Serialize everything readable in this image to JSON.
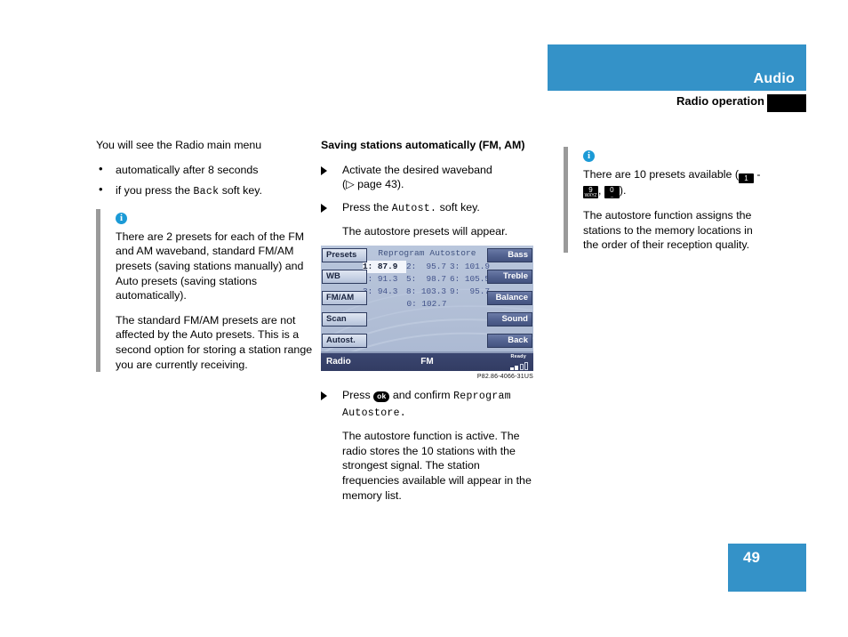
{
  "header": {
    "title": "Audio",
    "subtitle": "Radio operation",
    "band_color": "#3492c8"
  },
  "page": {
    "number": "49",
    "badge_color": "#3492c8"
  },
  "left_column": {
    "intro": "You will see the Radio main menu",
    "bullets": [
      "automatically after 8 seconds",
      "if you press the Back soft key."
    ],
    "bullet2_pre": "if you press the ",
    "bullet2_mono": "Back",
    "bullet2_post": " soft key.",
    "note": {
      "icon": "info-icon",
      "paragraphs": [
        "There are 2 presets for each of the FM and AM waveband, standard FM/AM presets (saving stations manually) and Auto presets (saving stations automatically).",
        "The standard FM/AM presets are not affected by the Auto presets. This is a second option for storing a station range you are currently receiving."
      ]
    }
  },
  "middle_column": {
    "heading": "Saving stations automatically (FM, AM)",
    "step1_line1": "Activate the desired waveband",
    "step1_line2_pre": "(",
    "step1_line2_ref": "▷ page 43",
    "step1_line2_post": ").",
    "step2_pre": "Press the ",
    "step2_mono": "Autost.",
    "step2_post": " soft key.",
    "step2_result": "The autostore presets will appear.",
    "step3_pre": "Press ",
    "step3_ok": "ok",
    "step3_mid": " and confirm ",
    "step3_mono1": "Reprogram",
    "step3_mono2": "Autostore.",
    "step3_result": "The autostore function is active. The radio stores the 10 stations with the strongest signal. The station frequencies available will appear in the memory list.",
    "figure_caption": "P82.86-4066-31US"
  },
  "right_column": {
    "note": {
      "icon": "info-icon",
      "line1_pre": "There are 10 presets available (",
      "key1": "1",
      "dash": " - ",
      "key9_main": "9",
      "key9_sub": "WXYZ",
      "comma": ", ",
      "key0_main": "0",
      "key0_sub": "_",
      "line1_post": ").",
      "paragraph2": "The autostore function assigns the stations to the memory locations in the order of their reception quality."
    }
  },
  "radio_screen": {
    "title": "Reprogram Autostore",
    "left_softkeys": [
      {
        "label": "Presets",
        "highlighted": true
      },
      {
        "label": "WB",
        "highlighted": true
      },
      {
        "label": "FM/AM",
        "highlighted": true
      },
      {
        "label": "Scan",
        "highlighted": true
      },
      {
        "label": "Autost.",
        "highlighted": true
      }
    ],
    "right_softkeys": [
      {
        "label": "Bass",
        "highlighted": false
      },
      {
        "label": "Treble",
        "highlighted": false
      },
      {
        "label": "Balance",
        "highlighted": false
      },
      {
        "label": "Sound",
        "highlighted": false
      },
      {
        "label": "Back",
        "highlighted": false
      }
    ],
    "presets": [
      [
        {
          "idx": "1:",
          "val": "87.9",
          "active": true
        },
        {
          "idx": "2:",
          "val": "95.7"
        },
        {
          "idx": "3:",
          "val": "101.9"
        }
      ],
      [
        {
          "idx": "2:",
          "val": "91.3"
        },
        {
          "idx": "5:",
          "val": "98.7"
        },
        {
          "idx": "6:",
          "val": "105.5"
        }
      ],
      [
        {
          "idx": "3:",
          "val": "94.3"
        },
        {
          "idx": "8:",
          "val": "103.3"
        },
        {
          "idx": "9:",
          "val": "95.7"
        }
      ],
      [
        {
          "idx": "0:",
          "val": "102.7"
        }
      ]
    ],
    "status": {
      "left": "Radio",
      "center": "FM",
      "ready": "Ready",
      "signal_level": 2,
      "signal_total": 4
    }
  }
}
